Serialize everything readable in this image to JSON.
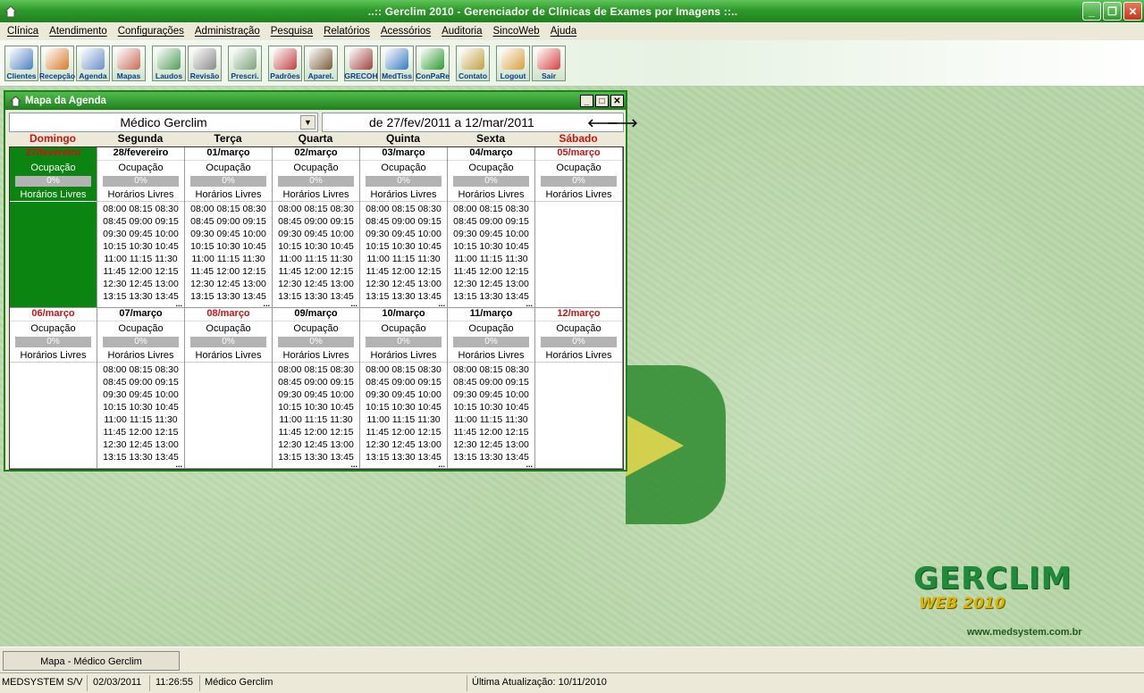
{
  "window": {
    "title": "..:: Gerclim 2010 - Gerenciador de Clínicas de Exames por Imagens ::.."
  },
  "menu": [
    "Clínica",
    "Atendimento",
    "Configurações",
    "Administração",
    "Pesquisa",
    "Relatórios",
    "Acessórios",
    "Auditoria",
    "SincoWeb",
    "Ajuda"
  ],
  "toolbar": [
    {
      "label": "Clientes",
      "color": "#4a7fc1"
    },
    {
      "label": "Recepção",
      "color": "#d67c2a"
    },
    {
      "label": "Agenda",
      "color": "#6b8fc9"
    },
    {
      "label": "Mapas",
      "color": "#c96b5a"
    },
    {
      "label": "Laudos",
      "color": "#4f9c5a"
    },
    {
      "label": "Revisão",
      "color": "#8a8a8a"
    },
    {
      "label": "Prescri.",
      "color": "#7aa37a"
    },
    {
      "label": "Padrões",
      "color": "#c04040"
    },
    {
      "label": "Aparel.",
      "color": "#7a5a3a"
    },
    {
      "label": "GRECOH",
      "color": "#a04040"
    },
    {
      "label": "MedTiss",
      "color": "#3a7ac0"
    },
    {
      "label": "ConPaRe",
      "color": "#2e9a2e"
    },
    {
      "label": "Contato",
      "color": "#c0a040"
    },
    {
      "label": "Logout",
      "color": "#d6a040"
    },
    {
      "label": "Sair",
      "color": "#d64040"
    }
  ],
  "agenda": {
    "title": "Mapa da Agenda",
    "medico": "Médico Gerclim",
    "range": "de 27/fev/2011 a 12/mar/2011",
    "days_of_week": [
      "Domingo",
      "Segunda",
      "Terça",
      "Quarta",
      "Quinta",
      "Sexta",
      "Sábado"
    ],
    "occupation_label": "Ocupação",
    "free_label": "Horários Livres",
    "slots": [
      "08:00 08:15 08:30",
      "08:45 09:00 09:15",
      "09:30 09:45 10:00",
      "10:15 10:30 10:45",
      "11:00 11:15 11:30",
      "11:45 12:00 12:15",
      "12:30 12:45 13:00",
      "13:15 13:30 13:45"
    ],
    "more": "...",
    "weeks": [
      [
        {
          "date": "27/fevereiro",
          "occupancy": "0%",
          "red": true,
          "selected": true,
          "has_slots": false
        },
        {
          "date": "28/fevereiro",
          "occupancy": "0%",
          "red": false,
          "selected": false,
          "has_slots": true
        },
        {
          "date": "01/março",
          "occupancy": "0%",
          "red": false,
          "selected": false,
          "has_slots": true
        },
        {
          "date": "02/março",
          "occupancy": "0%",
          "red": false,
          "selected": false,
          "has_slots": true
        },
        {
          "date": "03/março",
          "occupancy": "0%",
          "red": false,
          "selected": false,
          "has_slots": true
        },
        {
          "date": "04/março",
          "occupancy": "0%",
          "red": false,
          "selected": false,
          "has_slots": true
        },
        {
          "date": "05/março",
          "occupancy": "0%",
          "red": true,
          "selected": false,
          "has_slots": false
        }
      ],
      [
        {
          "date": "06/março",
          "occupancy": "0%",
          "red": true,
          "selected": false,
          "has_slots": false
        },
        {
          "date": "07/março",
          "occupancy": "0%",
          "red": false,
          "selected": false,
          "has_slots": true
        },
        {
          "date": "08/março",
          "occupancy": "0%",
          "red": true,
          "selected": false,
          "has_slots": false
        },
        {
          "date": "09/março",
          "occupancy": "0%",
          "red": false,
          "selected": false,
          "has_slots": true
        },
        {
          "date": "10/março",
          "occupancy": "0%",
          "red": false,
          "selected": false,
          "has_slots": true
        },
        {
          "date": "11/março",
          "occupancy": "0%",
          "red": false,
          "selected": false,
          "has_slots": true
        },
        {
          "date": "12/março",
          "occupancy": "0%",
          "red": true,
          "selected": false,
          "has_slots": false
        }
      ]
    ]
  },
  "brand": {
    "name": "GERCLIM",
    "sub": "WEB 2010",
    "url": "www.medsystem.com.br"
  },
  "taskbar": {
    "tab": "Mapa - Médico Gerclim"
  },
  "status": {
    "company": "MEDSYSTEM S/V",
    "date": "02/03/2011",
    "time": "11:26:55",
    "user": "Médico Gerclim",
    "update": "Última Atualização: 10/11/2010"
  }
}
